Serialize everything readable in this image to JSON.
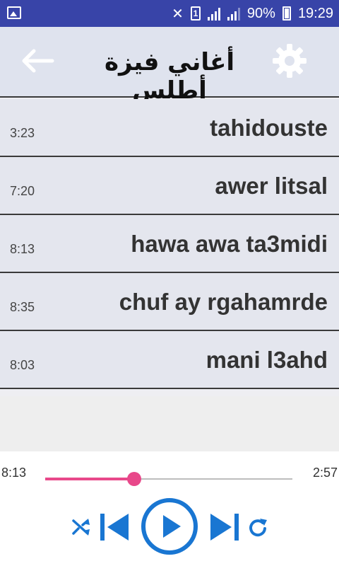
{
  "status_bar": {
    "battery": "90%",
    "time": "19:29",
    "sim_label": "1",
    "icons": [
      "gallery-icon",
      "mute-icon",
      "sim-icon",
      "signal-icon",
      "battery-icon"
    ]
  },
  "app_bar": {
    "title": "أغاني فيزة أطلس",
    "back_icon": "arrow-left-icon",
    "settings_icon": "gear-icon"
  },
  "songs": [
    {
      "title": "tahidouste",
      "duration": "3:23"
    },
    {
      "title": "awer litsal",
      "duration": "7:20"
    },
    {
      "title": "hawa awa ta3midi",
      "duration": "8:13"
    },
    {
      "title": "chuf ay rgahamrde",
      "duration": "8:35"
    },
    {
      "title": "mani l3ahd",
      "duration": "8:03"
    }
  ],
  "player": {
    "current_time": "8:13",
    "total_time": "2:57",
    "progress": 0.36,
    "colors": {
      "accent": "#e8488a",
      "controls": "#1976d2",
      "header": "#3844a8"
    },
    "controls": [
      "shuffle-icon",
      "previous-icon",
      "play-icon",
      "next-icon",
      "repeat-icon"
    ]
  }
}
